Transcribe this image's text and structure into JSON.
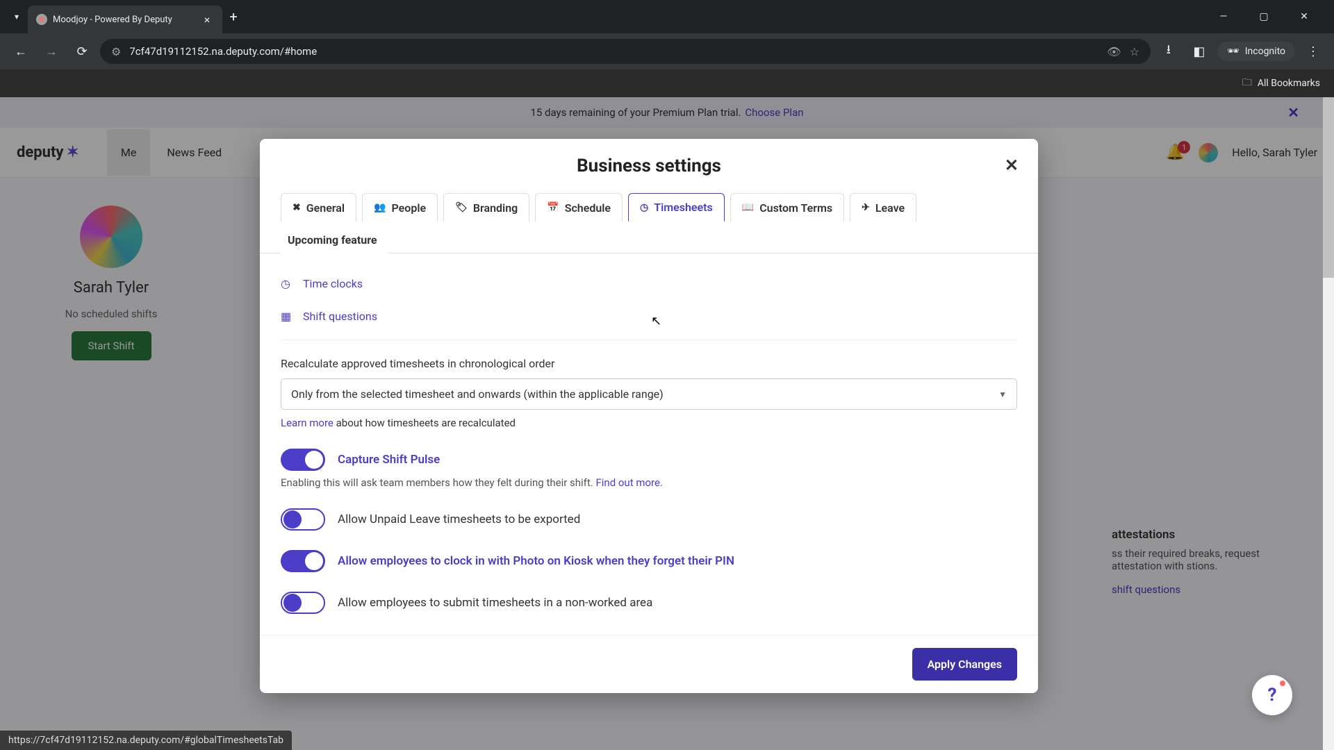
{
  "browser": {
    "tab_title": "Moodjoy - Powered By Deputy",
    "url": "7cf47d19112152.na.deputy.com/#home",
    "incognito": "Incognito",
    "all_bookmarks": "All Bookmarks"
  },
  "trial": {
    "text": "15 days remaining of your Premium Plan trial.",
    "link": "Choose Plan"
  },
  "header": {
    "logo": "deputy",
    "nav": {
      "me": "Me",
      "newsfeed": "News Feed"
    },
    "badge_count": "1",
    "hello": "Hello, Sarah Tyler"
  },
  "sidebar": {
    "name": "Sarah Tyler",
    "no_shifts": "No scheduled shifts",
    "start_shift": "Start Shift"
  },
  "modal": {
    "title": "Business settings",
    "tabs": {
      "general": "General",
      "people": "People",
      "branding": "Branding",
      "schedule": "Schedule",
      "timesheets": "Timesheets",
      "custom_terms": "Custom Terms",
      "leave": "Leave",
      "upcoming": "Upcoming feature"
    },
    "sections": {
      "time_clocks": "Time clocks",
      "shift_questions": "Shift questions"
    },
    "recalc": {
      "label": "Recalculate approved timesheets in chronological order",
      "value": "Only from the selected timesheet and onwards (within the applicable range)",
      "learn_more": "Learn more",
      "learn_more_rest": " about how timesheets are recalculated"
    },
    "toggles": {
      "capture_pulse": "Capture Shift Pulse",
      "capture_pulse_desc": "Enabling this will ask team members how they felt during their shift. ",
      "find_out_more": "Find out more.",
      "unpaid_leave": "Allow Unpaid Leave timesheets to be exported",
      "photo_kiosk": "Allow employees to clock in with Photo on Kiosk when they forget their PIN",
      "nonworked": "Allow employees to submit timesheets in a non-worked area"
    },
    "apply": "Apply Changes"
  },
  "right_panel": {
    "title": "attestations",
    "text": "ss their required breaks, request attestation with stions.",
    "link": "shift questions"
  },
  "status": "https://7cf47d19112152.na.deputy.com/#globalTimesheetsTab"
}
